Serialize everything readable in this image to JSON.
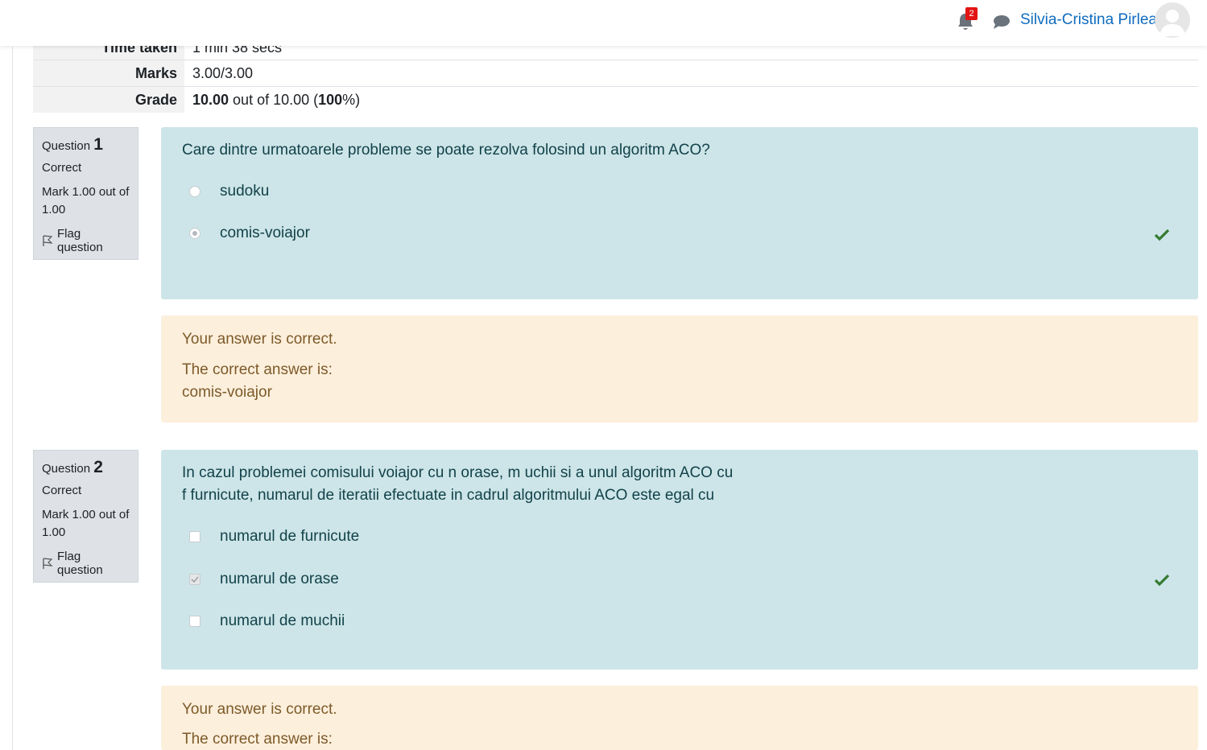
{
  "header": {
    "notification_count": "2",
    "user_name": "Silvia-Cristina Pirlea"
  },
  "summary": {
    "time_taken_label": "Time taken",
    "time_taken_value": "1 min 38 secs",
    "marks_label": "Marks",
    "marks_value": "3.00/3.00",
    "grade_label": "Grade",
    "grade_value": "10.00",
    "grade_mid": " out of 10.00 (",
    "grade_percent": "100",
    "grade_end": "%)"
  },
  "questions": [
    {
      "label": "Question",
      "number": "1",
      "state": "Correct",
      "mark": "Mark 1.00 out of 1.00",
      "flag": "Flag question",
      "text": "Care dintre urmatoarele probleme se poate rezolva folosind un algoritm ACO?",
      "answers": [
        "sudoku",
        "comis-voiajor"
      ],
      "feedback": "Your answer is correct.",
      "correct_label": "The correct answer is:",
      "correct_answer": "comis-voiajor"
    },
    {
      "label": "Question",
      "number": "2",
      "state": "Correct",
      "mark": "Mark 1.00 out of 1.00",
      "flag": "Flag question",
      "text_line1": "In cazul problemei comisului voiajor cu n orase, m uchii si a unul algoritm ACO cu",
      "text_line2": "f furnicute, numarul de iteratii efectuate in cadrul algoritmului ACO este egal cu",
      "answers": [
        "numarul de furnicute",
        "numarul de orase",
        "numarul de muchii"
      ],
      "feedback": "Your answer is correct.",
      "correct_label": "The correct answer is:"
    }
  ],
  "colors": {
    "accent": "#0f6cbf",
    "correct_bg": "#cde5e8",
    "feedback_bg": "#fcefdc",
    "tick": "#357a32"
  }
}
